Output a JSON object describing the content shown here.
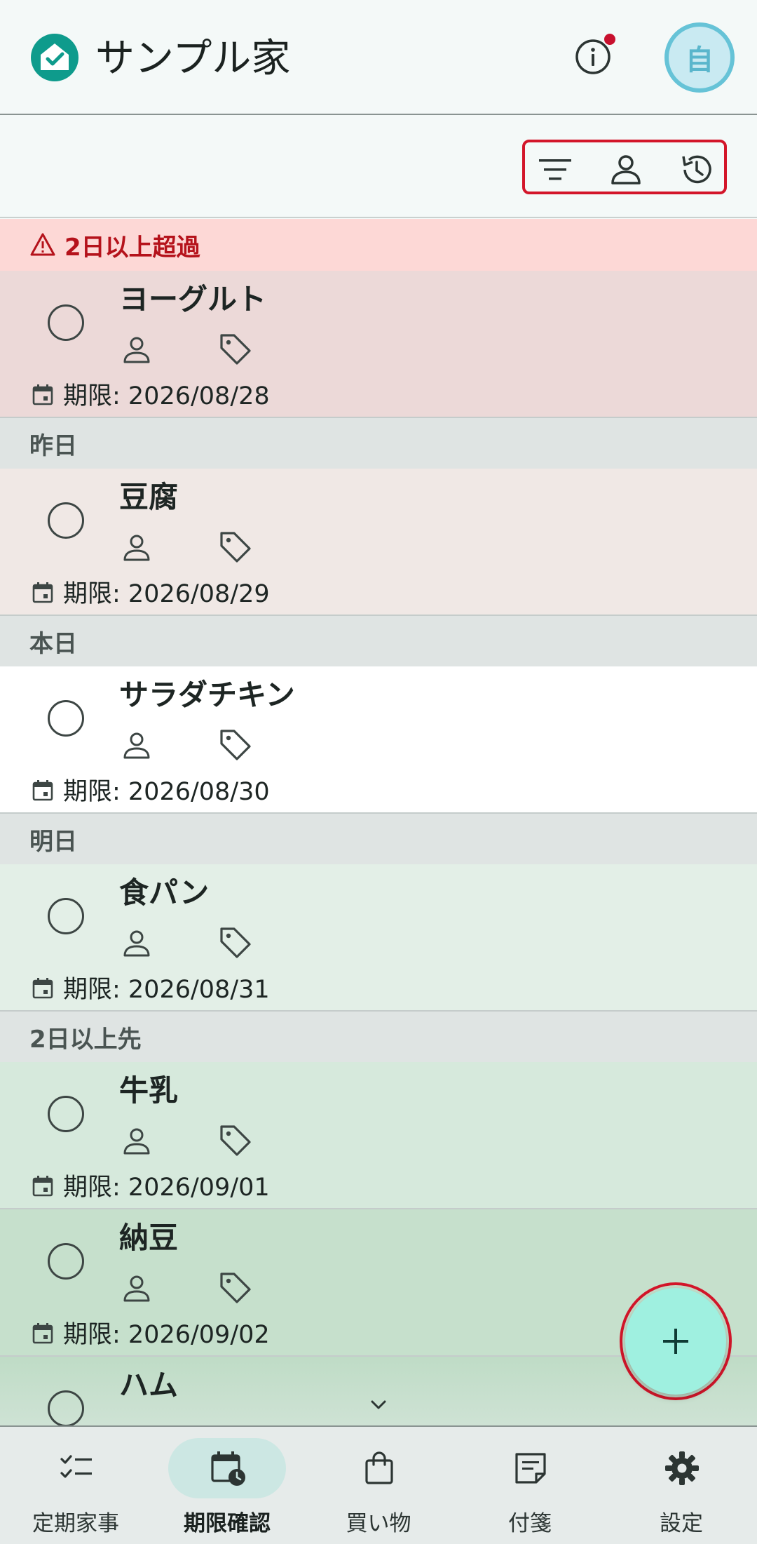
{
  "app": {
    "title": "サンプル家",
    "avatar_label": "自"
  },
  "colors": {
    "accent": "#0e9b8c",
    "fab": "#9ff0e0",
    "alert": "#b5121b"
  },
  "toolbar": {
    "icons": [
      "filter-icon",
      "person-icon",
      "history-icon"
    ]
  },
  "groups": [
    {
      "label": "2日以上超過",
      "type": "overdue",
      "background": "#fdd8d6"
    },
    {
      "label": "昨日",
      "type": "yesterday",
      "background": "#dfe4e3"
    },
    {
      "label": "本日",
      "type": "today",
      "background": "#dfe4e3"
    },
    {
      "label": "明日",
      "type": "tomorrow",
      "background": "#dfe4e3"
    },
    {
      "label": "2日以上先",
      "type": "future",
      "background": "#dfe4e3"
    }
  ],
  "items": [
    {
      "name": "ヨーグルト",
      "due": "期限: 2026/08/28",
      "background": "#ecd9d8"
    },
    {
      "name": "豆腐",
      "due": "期限: 2026/08/29",
      "background": "#f0e8e5"
    },
    {
      "name": "サラダチキン",
      "due": "期限: 2026/08/30",
      "background": "#ffffff"
    },
    {
      "name": "食パン",
      "due": "期限: 2026/08/31",
      "background": "#e3efe7"
    },
    {
      "name": "牛乳",
      "due": "期限: 2026/09/01",
      "background": "#d6e9dc"
    },
    {
      "name": "納豆",
      "due": "期限: 2026/09/02",
      "background": "#c6e0cc"
    },
    {
      "name": "ハム",
      "due": "",
      "background": "#bfdcc6"
    }
  ],
  "nav": {
    "items": [
      {
        "label": "定期家事",
        "icon": "checklist-icon",
        "active": false
      },
      {
        "label": "期限確認",
        "icon": "calendar-clock-icon",
        "active": true
      },
      {
        "label": "買い物",
        "icon": "shopping-bag-icon",
        "active": false
      },
      {
        "label": "付箋",
        "icon": "sticky-note-icon",
        "active": false
      },
      {
        "label": "設定",
        "icon": "gear-icon",
        "active": false
      }
    ]
  }
}
